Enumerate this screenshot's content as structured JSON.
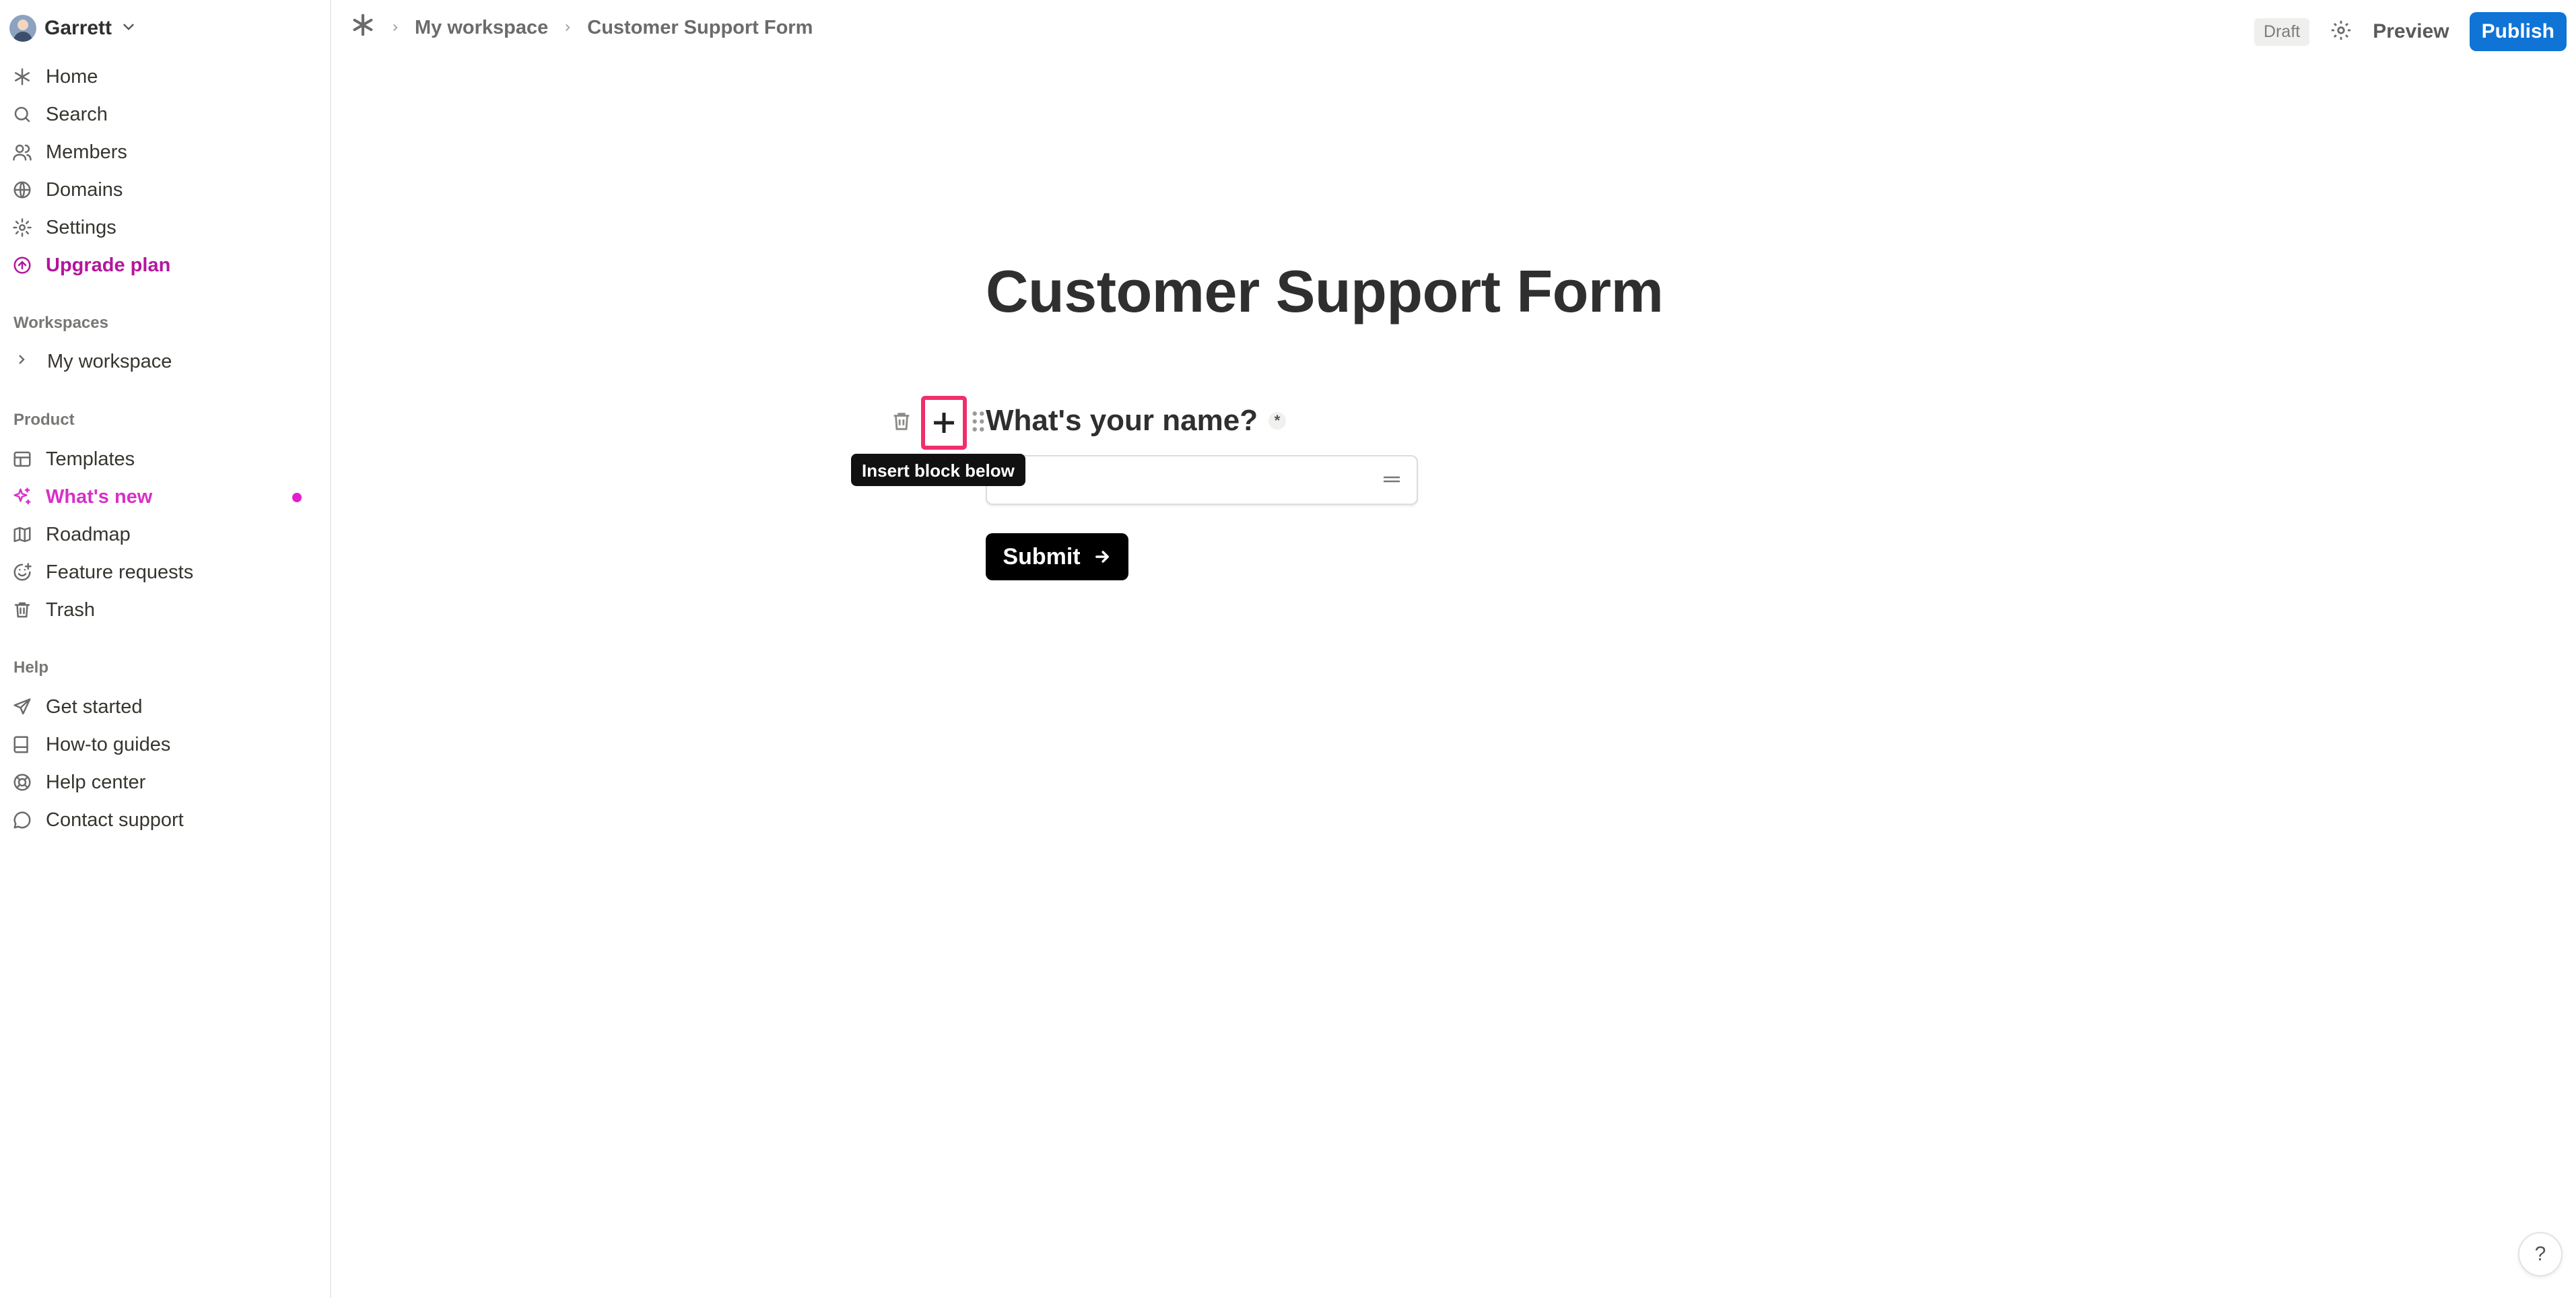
{
  "user": {
    "name": "Garrett"
  },
  "sidebar": {
    "nav": [
      {
        "label": "Home",
        "icon": "asterisk-icon"
      },
      {
        "label": "Search",
        "icon": "search-icon"
      },
      {
        "label": "Members",
        "icon": "users-icon"
      },
      {
        "label": "Domains",
        "icon": "globe-icon"
      },
      {
        "label": "Settings",
        "icon": "gear-icon"
      },
      {
        "label": "Upgrade plan",
        "icon": "arrow-up-circle-icon"
      }
    ],
    "workspaces_label": "Workspaces",
    "workspaces": [
      {
        "label": "My workspace"
      }
    ],
    "product_label": "Product",
    "product": [
      {
        "label": "Templates",
        "icon": "layout-icon"
      },
      {
        "label": "What's new",
        "icon": "sparkles-icon"
      },
      {
        "label": "Roadmap",
        "icon": "map-icon"
      },
      {
        "label": "Feature requests",
        "icon": "smile-plus-icon"
      },
      {
        "label": "Trash",
        "icon": "trash-icon"
      }
    ],
    "help_label": "Help",
    "help": [
      {
        "label": "Get started",
        "icon": "send-icon"
      },
      {
        "label": "How-to guides",
        "icon": "book-icon"
      },
      {
        "label": "Help center",
        "icon": "lifebuoy-icon"
      },
      {
        "label": "Contact support",
        "icon": "message-circle-icon"
      }
    ],
    "colors": {
      "upgrade": "#b4169c",
      "whats_new": "#d92fc7",
      "badge_dot": "#e21fd0"
    }
  },
  "topbar": {
    "breadcrumb": [
      "My workspace",
      "Customer Support Form"
    ],
    "draft_label": "Draft",
    "preview_label": "Preview",
    "publish_label": "Publish",
    "publish_color": "#0f74d6"
  },
  "form": {
    "title": "Customer Support Form",
    "question": "What's your name?",
    "required_mark": "*",
    "input_value": "",
    "tooltip": "Insert block below",
    "submit_label": "Submit"
  },
  "help_fab": "?"
}
